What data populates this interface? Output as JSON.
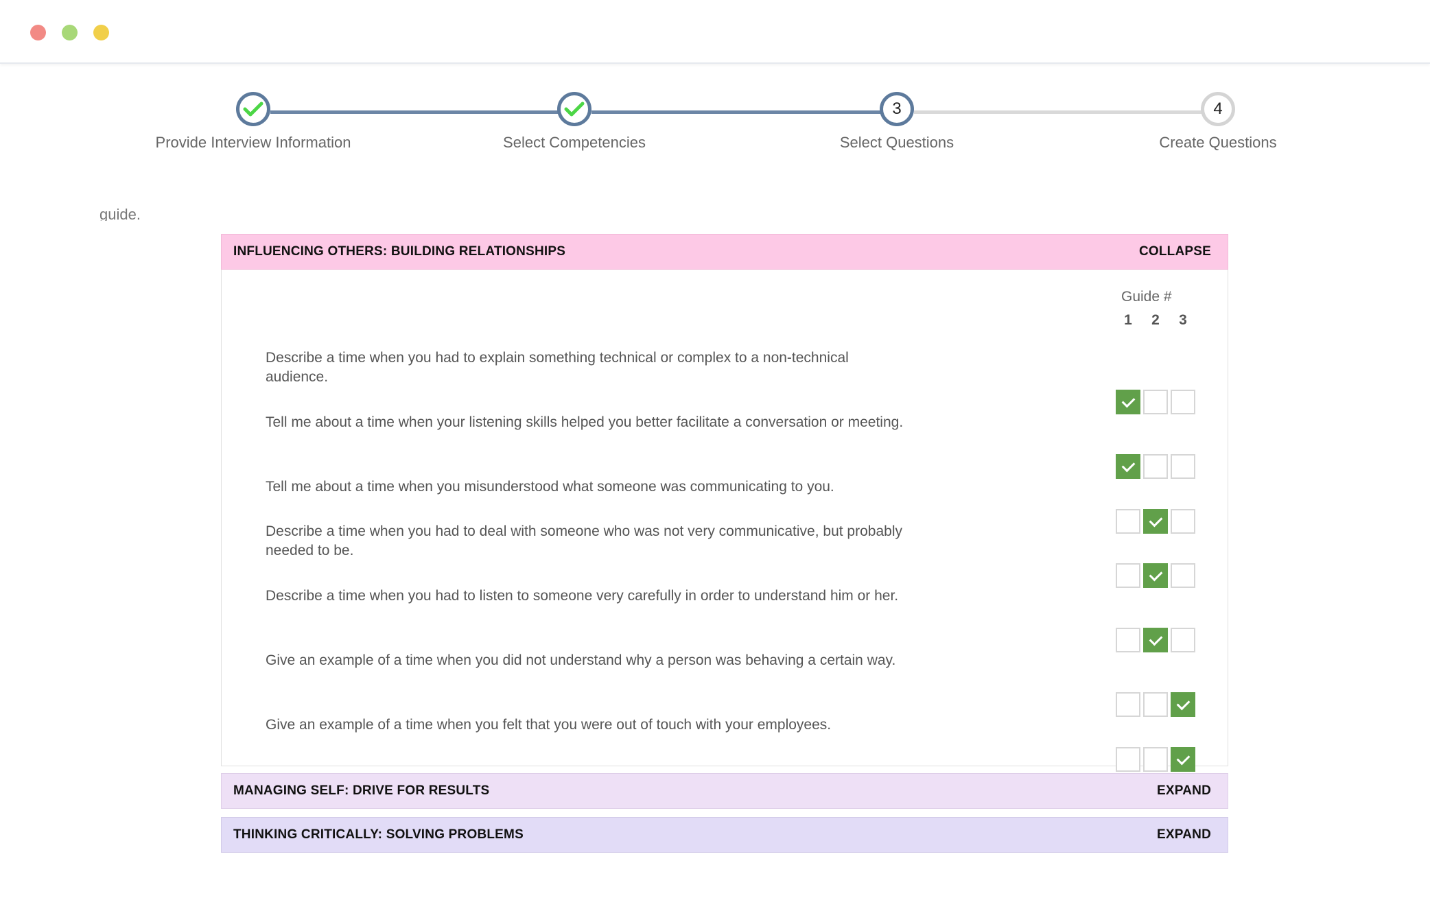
{
  "stepper": {
    "steps": [
      {
        "label": "Provide Interview Information",
        "status": "done",
        "icon": "check-icon"
      },
      {
        "label": "Select Competencies",
        "status": "done",
        "icon": "check-icon"
      },
      {
        "label": "Select Questions",
        "status": "current",
        "number": "3"
      },
      {
        "label": "Create Questions",
        "status": "todo",
        "number": "4"
      }
    ],
    "check_color": "#4cd646"
  },
  "cut_text": "guide.",
  "sections": [
    {
      "title": "INFLUENCING OTHERS: BUILDING RELATIONSHIPS",
      "toggle": "COLLAPSE",
      "guide_label": "Guide #",
      "guide_numbers": [
        "1",
        "2",
        "3"
      ],
      "questions": [
        {
          "text": "Describe a time when you had to explain something technical or complex to a non-technical audience.",
          "checks": [
            true,
            false,
            false
          ]
        },
        {
          "text": "Tell me about a time when your listening skills helped you better facilitate a conversation or meeting.",
          "checks": [
            true,
            false,
            false
          ]
        },
        {
          "text": "Tell me about a time when you misunderstood what someone was communicating to you.",
          "checks": [
            false,
            true,
            false
          ]
        },
        {
          "text": "Describe a time when you had to deal with someone who was not very communicative, but probably needed to be.",
          "checks": [
            false,
            true,
            false
          ]
        },
        {
          "text": "Describe a time when you had to listen to someone very carefully in order to understand him or her.",
          "checks": [
            false,
            true,
            false
          ]
        },
        {
          "text": "Give an example of a time when you did not understand why a person was behaving a certain way.",
          "checks": [
            false,
            false,
            true
          ]
        },
        {
          "text": "Give an example of a time when you felt that you were out of touch with your employees.",
          "checks": [
            false,
            false,
            true
          ]
        }
      ]
    },
    {
      "title": "MANAGING SELF: DRIVE FOR RESULTS",
      "toggle": "EXPAND"
    },
    {
      "title": "THINKING CRITICALLY: SOLVING PROBLEMS",
      "toggle": "EXPAND"
    }
  ],
  "colors": {
    "accent": "#5d7a9c",
    "checked": "#61a04a",
    "section1": "#fdc9e6",
    "section2": "#eee0f6",
    "section3": "#e2dcf7"
  }
}
